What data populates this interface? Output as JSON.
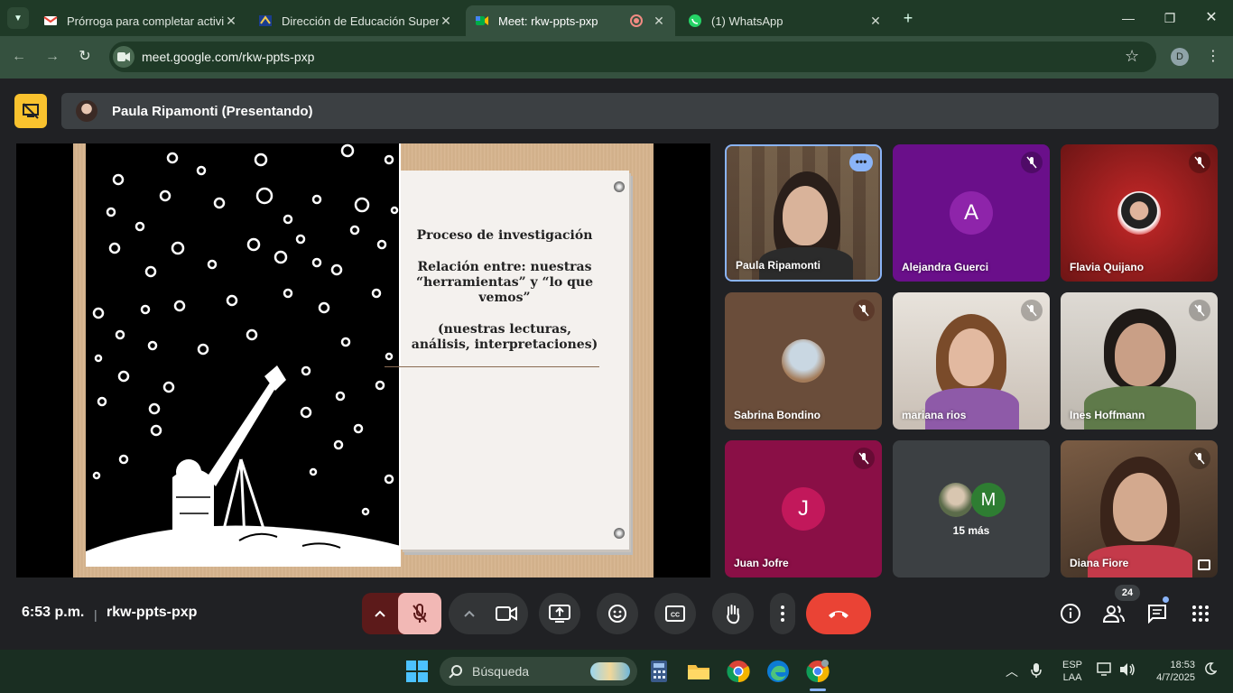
{
  "browser": {
    "tabs": [
      {
        "label": "Prórroga para completar activid",
        "icon": "gmail-icon"
      },
      {
        "label": "Dirección de Educación Superio",
        "icon": "edu-icon"
      },
      {
        "label": "Meet: rkw-ppts-pxp",
        "icon": "meet-icon",
        "active": true
      },
      {
        "label": "(1) WhatsApp",
        "icon": "whatsapp-icon"
      }
    ],
    "url": "meet.google.com/rkw-ppts-pxp",
    "profile_initial": "D"
  },
  "meet": {
    "presenter_banner": "Paula Ripamonti (Presentando)",
    "slide": {
      "title": "Proceso de investigación",
      "line1": "Relación entre: nuestras “herramientas” y “lo que vemos”",
      "line2": "(nuestras lecturas, análisis, interpretaciones)"
    },
    "participants": [
      {
        "name": "Paula Ripamonti"
      },
      {
        "name": "Alejandra Guerci",
        "initial": "A"
      },
      {
        "name": "Flavia Quijano"
      },
      {
        "name": "Sabrina Bondino"
      },
      {
        "name": "mariana rios"
      },
      {
        "name": "Ines Hoffmann"
      },
      {
        "name": "Juan Jofre",
        "initial": "J"
      },
      {
        "name": "15 más",
        "initial": "M"
      },
      {
        "name": "Diana Fiore"
      }
    ],
    "time": "6:53 p.m.",
    "separator": "|",
    "meeting_code": "rkw-ppts-pxp",
    "people_count": "24",
    "colors": {
      "hangup": "#ea4335",
      "present_accent": "#f9c22e",
      "mic_off": "#f2b8b5"
    }
  },
  "taskbar": {
    "search_placeholder": "Búsqueda",
    "lang_line1": "ESP",
    "lang_line2": "LAA",
    "clock_time": "18:53",
    "clock_date": "4/7/2025"
  }
}
